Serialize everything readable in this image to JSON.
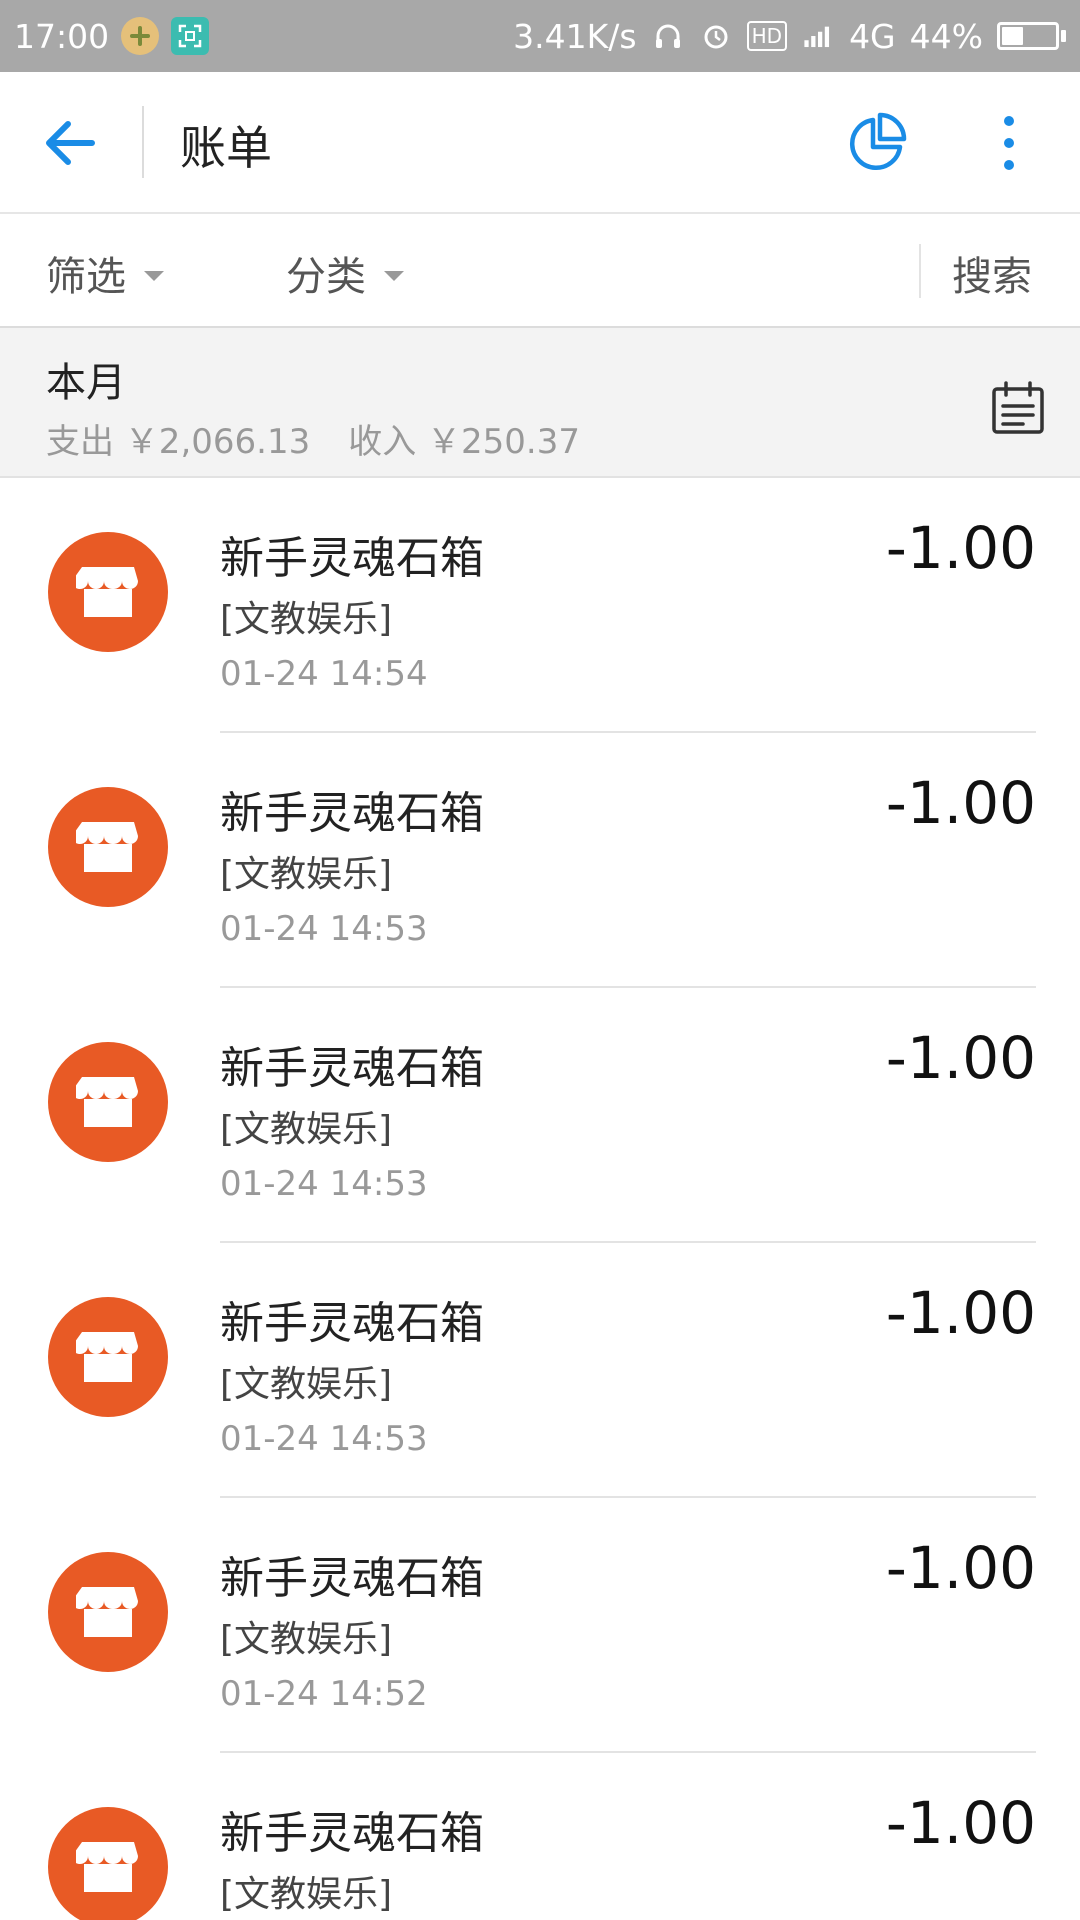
{
  "status_bar": {
    "time": "17:00",
    "network_speed": "3.41K/s",
    "hd_label": "HD",
    "network_type": "4G",
    "battery_percent": "44%",
    "battery_level": 0.44
  },
  "app_bar": {
    "title": "账单"
  },
  "filter_bar": {
    "filter_label": "筛选",
    "category_label": "分类",
    "search_label": "搜索"
  },
  "month_summary": {
    "title": "本月",
    "expense_label": "支出 ￥2,066.13",
    "income_label": "收入 ￥250.37"
  },
  "bills": [
    {
      "name": "新手灵魂石箱",
      "category": "[文教娱乐]",
      "time": "01-24  14:54",
      "amount": "-1.00"
    },
    {
      "name": "新手灵魂石箱",
      "category": "[文教娱乐]",
      "time": "01-24  14:53",
      "amount": "-1.00"
    },
    {
      "name": "新手灵魂石箱",
      "category": "[文教娱乐]",
      "time": "01-24  14:53",
      "amount": "-1.00"
    },
    {
      "name": "新手灵魂石箱",
      "category": "[文教娱乐]",
      "time": "01-24  14:53",
      "amount": "-1.00"
    },
    {
      "name": "新手灵魂石箱",
      "category": "[文教娱乐]",
      "time": "01-24  14:52",
      "amount": "-1.00"
    },
    {
      "name": "新手灵魂石箱",
      "category": "[文教娱乐]",
      "time": "",
      "amount": "-1.00"
    }
  ],
  "icons": {
    "back": "arrow-left-icon",
    "stats": "pie-chart-icon",
    "more": "more-vertical-icon",
    "calendar": "calendar-icon",
    "bill": "store-icon"
  },
  "colors": {
    "accent": "#1a8ce6",
    "bill_icon_bg": "#e85a25",
    "status_bar_bg": "#a8a8a8",
    "summary_bg": "#f3f3f3"
  }
}
